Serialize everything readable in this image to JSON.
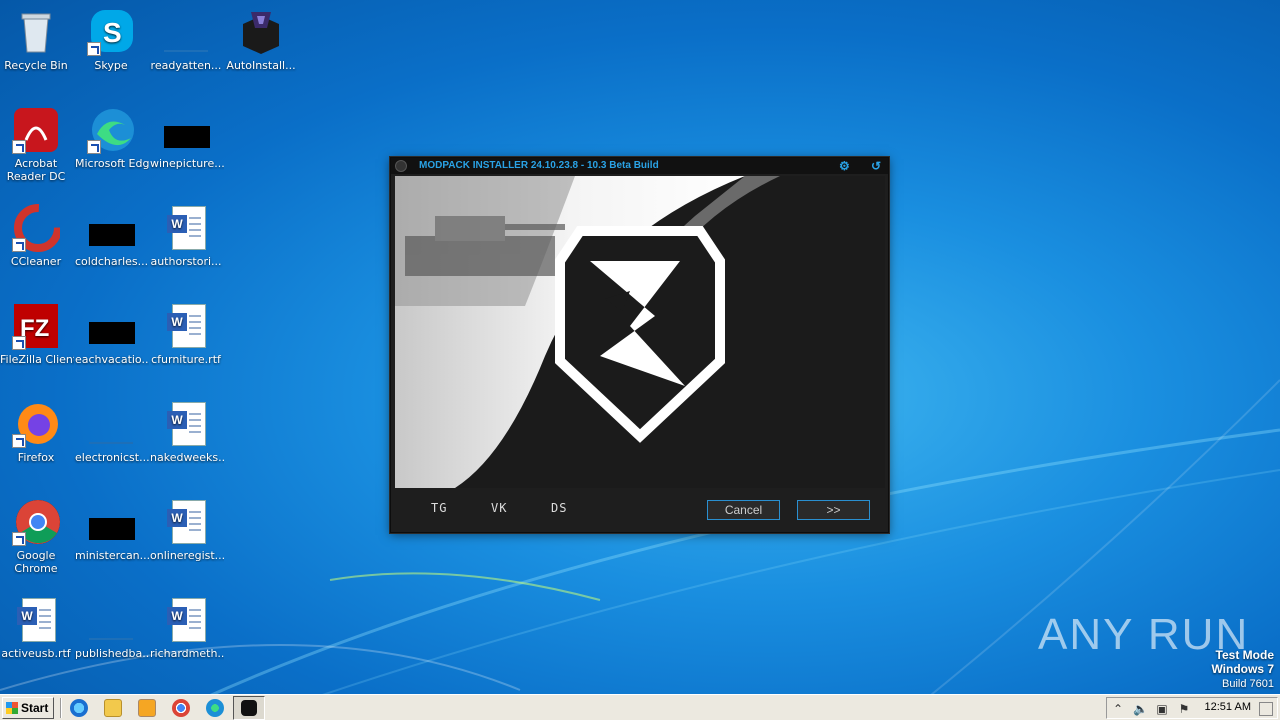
{
  "desktop": {
    "icons": [
      {
        "label": "Recycle Bin",
        "icon": "recycle-bin-icon"
      },
      {
        "label": "Skype",
        "icon": "skype-icon"
      },
      {
        "label": "readyatten...",
        "icon": "file-icon"
      },
      {
        "label": "AutoInstall...",
        "icon": "autoinstaller-icon"
      },
      {
        "label": "Acrobat Reader DC",
        "icon": "acrobat-icon"
      },
      {
        "label": "Microsoft Edge",
        "icon": "edge-icon"
      },
      {
        "label": "winepicture...",
        "icon": "image-file-icon"
      },
      {
        "label": "CCleaner",
        "icon": "ccleaner-icon"
      },
      {
        "label": "coldcharles...",
        "icon": "image-file-icon"
      },
      {
        "label": "authorstori...",
        "icon": "word-doc-icon"
      },
      {
        "label": "FileZilla Client",
        "icon": "filezilla-icon"
      },
      {
        "label": "eachvacatio...",
        "icon": "image-file-icon"
      },
      {
        "label": "cfurniture.rtf",
        "icon": "word-doc-icon"
      },
      {
        "label": "Firefox",
        "icon": "firefox-icon"
      },
      {
        "label": "electronicst...",
        "icon": "file-icon"
      },
      {
        "label": "nakedweeks...",
        "icon": "word-doc-icon"
      },
      {
        "label": "Google Chrome",
        "icon": "chrome-icon"
      },
      {
        "label": "ministercan...",
        "icon": "image-file-icon"
      },
      {
        "label": "onlineregist...",
        "icon": "word-doc-icon"
      },
      {
        "label": "activeusb.rtf",
        "icon": "word-doc-icon"
      },
      {
        "label": "publishedba...",
        "icon": "file-icon"
      },
      {
        "label": "richardmeth...",
        "icon": "word-doc-icon"
      }
    ]
  },
  "installer": {
    "title": "MODPACK INSTALLER 24.10.23.8  - 10.3 Beta Build",
    "links": [
      "TG",
      "VK",
      "DS"
    ],
    "cancel_label": "Cancel",
    "next_label": ">>"
  },
  "taskbar": {
    "start_label": "Start",
    "clock": "12:51 AM"
  },
  "watermark": {
    "brand": "ANY RUN",
    "mode": "Test Mode",
    "os": "Windows 7",
    "build": "Build 7601"
  }
}
